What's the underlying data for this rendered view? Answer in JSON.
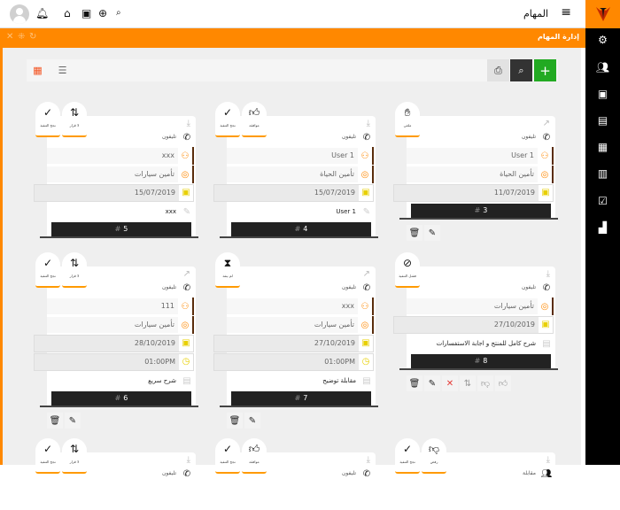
{
  "header": {
    "title": "المهام",
    "icons": [
      "home-icon",
      "save-icon",
      "globe-icon",
      "search-icon",
      "bell-icon"
    ]
  },
  "panel": {
    "title": "إدارة المهام"
  },
  "colors": {
    "accent": "#ff8800",
    "sidebar": "#000000",
    "add": "#22aa22"
  },
  "cards": [
    {
      "badges": [
        {
          "label": "نجح التنفيذ",
          "icon": "check"
        },
        {
          "label": "لا قرار",
          "icon": "mixed"
        }
      ],
      "arrow": "download",
      "type": "تليفون",
      "type_icon": "phone",
      "user": "xxx",
      "category": "تأمين سيارات",
      "date": "15/07/2019",
      "note": "xxx",
      "note_icon": "pencil",
      "number": "5",
      "actions": []
    },
    {
      "badges": [
        {
          "label": "نجح التنفيذ",
          "icon": "check"
        },
        {
          "label": "موافقة",
          "icon": "like"
        }
      ],
      "arrow": "download",
      "type": "تليفون",
      "type_icon": "phone",
      "user": "User 1",
      "category": "تأمين الحياة",
      "date": "15/07/2019",
      "note": "User 1",
      "note_icon": "pencil",
      "number": "4",
      "actions": []
    },
    {
      "badges": [
        {
          "label": "ملغي",
          "icon": "hand"
        }
      ],
      "arrow": "open",
      "type": "تليفون",
      "type_icon": "phone",
      "user": "User 1",
      "category": "تأمين الحياة",
      "date": "11/07/2019",
      "number": "3",
      "actions": [
        "delete",
        "edit"
      ]
    },
    {
      "badges": [
        {
          "label": "نجح التنفيذ",
          "icon": "check"
        },
        {
          "label": "لا قرار",
          "icon": "mixed"
        }
      ],
      "arrow": "open",
      "type": "تليفون",
      "type_icon": "phone",
      "user": "111",
      "category": "تأمين سيارات",
      "date": "28/10/2019",
      "time": "01:00PM",
      "note": "شرح سريع",
      "note_icon": "doc",
      "number": "6",
      "actions": [
        "delete",
        "edit"
      ]
    },
    {
      "badges": [
        {
          "label": "لم ينفذ",
          "icon": "hourglass"
        }
      ],
      "arrow": "open",
      "type": "تليفون",
      "type_icon": "phone",
      "user": "xxx",
      "category": "تأمين سيارات",
      "date": "27/10/2019",
      "time": "01:00PM",
      "note": "مقابلة توضيح",
      "note_icon": "doc",
      "number": "7",
      "actions": [
        "delete",
        "edit"
      ]
    },
    {
      "badges": [
        {
          "label": "فشل التنفيذ",
          "icon": "hidden"
        }
      ],
      "arrow": "download",
      "type": "تليفون",
      "type_icon": "phone",
      "category": "تأمين سيارات",
      "date": "27/10/2019",
      "note": "شرح كامل للمنتج و اجابة الاستفسارات",
      "note_icon": "doc",
      "number": "8",
      "actions": [
        "delete",
        "edit",
        "cancel",
        "mixed",
        "dislike",
        "like"
      ]
    },
    {
      "badges": [
        {
          "label": "نجح التنفيذ",
          "icon": "check"
        },
        {
          "label": "لا قرار",
          "icon": "mixed"
        }
      ],
      "arrow": "download",
      "type": "تليفون",
      "type_icon": "phone"
    },
    {
      "badges": [
        {
          "label": "نجح التنفيذ",
          "icon": "check"
        },
        {
          "label": "موافقة",
          "icon": "like"
        }
      ],
      "arrow": "download",
      "type": "تليفون",
      "type_icon": "phone"
    },
    {
      "badges": [
        {
          "label": "نجح التنفيذ",
          "icon": "check"
        },
        {
          "label": "رفض",
          "icon": "dislike"
        }
      ],
      "arrow": "download",
      "type": "مقابلة",
      "type_icon": "group"
    }
  ]
}
